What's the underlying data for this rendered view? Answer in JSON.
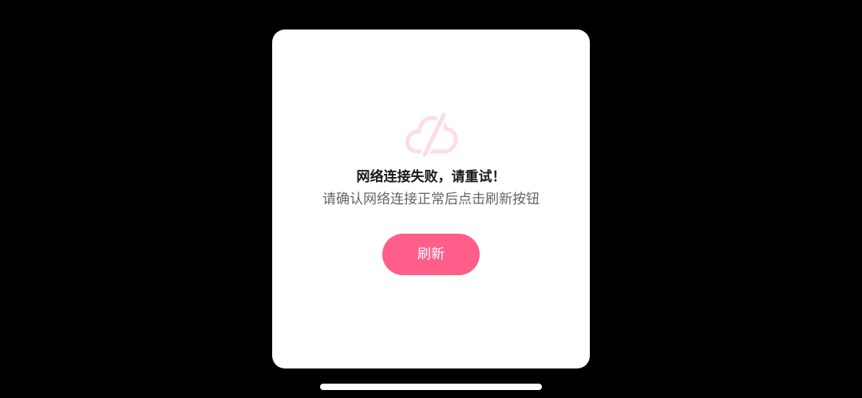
{
  "dialog": {
    "icon": "cloud-offline-icon",
    "title": "网络连接失败，请重试！",
    "message": "请确认网络连接正常后点击刷新按钮",
    "refresh_label": "刷新"
  },
  "colors": {
    "background": "#000000",
    "dialog": "#ffffff",
    "accent": "#ff5d8a",
    "icon": "#fcdde6",
    "title_text": "#1a1a1a",
    "message_text": "#666666"
  }
}
